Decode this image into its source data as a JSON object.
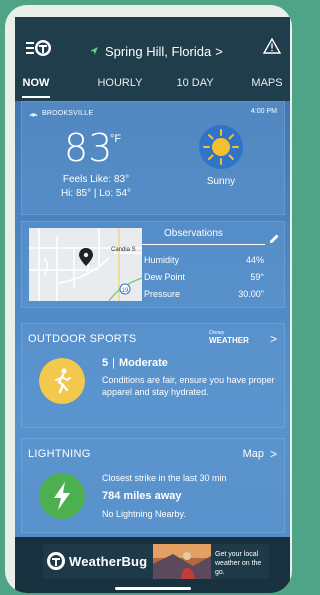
{
  "header": {
    "location": "Spring Hill, Florida",
    "location_chevron": ">",
    "menu_icon": "menu-bug-icon",
    "alert_icon": "alert-triangle-icon"
  },
  "tabs": [
    {
      "label": "NOW",
      "active": true
    },
    {
      "label": "HOURLY",
      "active": false
    },
    {
      "label": "10 DAY",
      "active": false
    },
    {
      "label": "MAPS",
      "active": false
    }
  ],
  "current": {
    "station": "BROOKSVILLE",
    "time": "4:00 PM",
    "temp": "83",
    "unit": "°F",
    "feels_like": "Feels Like: 83°",
    "hi_lo": "Hi: 85° | Lo: 54°",
    "condition": "Sunny",
    "condition_icon": "sun-icon"
  },
  "observations": {
    "title": "Observations",
    "map_label": "Candia S",
    "rows": [
      {
        "label": "Humidity",
        "value": "44%"
      },
      {
        "label": "Dew Point",
        "value": "59°"
      },
      {
        "label": "Pressure",
        "value": "30.00\""
      }
    ]
  },
  "outdoor_sports": {
    "title": "OUTDOOR SPORTS",
    "sponsor_top": "Disney",
    "sponsor": "WEATHER",
    "index": "5",
    "separator": "|",
    "rating": "Moderate",
    "description": "Conditions are fair, ensure you have proper apparel and stay hydrated.",
    "chevron": ">"
  },
  "lightning": {
    "title": "LIGHTNING",
    "map_link": "Map",
    "chevron": ">",
    "line1": "Closest strike in the last 30 min",
    "distance": "784 miles away",
    "status": "No Lightning Nearby."
  },
  "ad": {
    "brand": "WeatherBug",
    "text": "Get your local weather on the go."
  },
  "colors": {
    "topbar": "#1f3d4a",
    "sports_badge": "#f2c94c",
    "lightning_badge": "#4caf50",
    "sun": "#f5c02f"
  }
}
